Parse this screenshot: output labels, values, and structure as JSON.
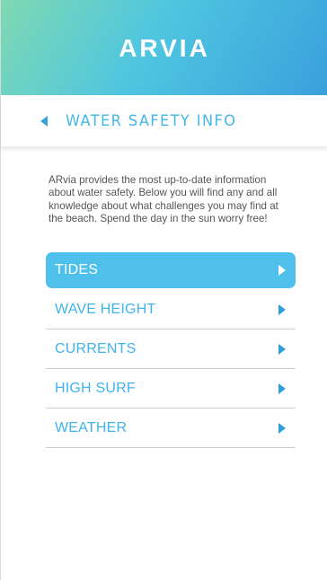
{
  "header": {
    "title": "ARVIA"
  },
  "subheader": {
    "title": "WATER SAFETY INFO"
  },
  "intro": {
    "text": "ARvia provides the most up-to-date information about water safety. Below you will find any and all knowledge about what challenges you may find at the beach. Spend the day in the sun worry free!"
  },
  "menu": {
    "items": [
      {
        "label": "TIDES",
        "active": true
      },
      {
        "label": "WAVE HEIGHT",
        "active": false
      },
      {
        "label": "CURRENTS",
        "active": false
      },
      {
        "label": "HIGH SURF",
        "active": false
      },
      {
        "label": "WEATHER",
        "active": false
      }
    ]
  },
  "colors": {
    "accent": "#4fc0ec",
    "text_accent": "#3eb4ea",
    "gradient_start": "#7fd9b2",
    "gradient_end": "#3aa0dc"
  }
}
